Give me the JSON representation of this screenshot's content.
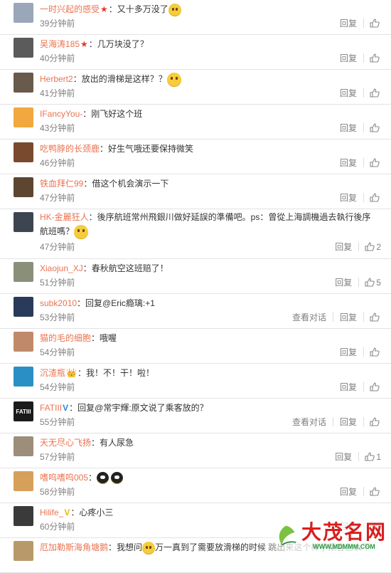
{
  "actions": {
    "reply": "回复",
    "view_thread": "查看对话"
  },
  "comments": [
    {
      "user": "一时兴起的感受",
      "badge": "★",
      "badge_type": "star",
      "text": "：又十多万没了",
      "emoji": "cat",
      "time": "39分钟前",
      "likes": "",
      "thread": false,
      "avatar": "#9aa7b8"
    },
    {
      "user": "吴海涛185",
      "badge": "★",
      "badge_type": "star",
      "text": "：几万块没了？",
      "emoji": "",
      "time": "40分钟前",
      "likes": "",
      "thread": false,
      "avatar": "#5b5b5b"
    },
    {
      "user": "Herbert2",
      "badge": "",
      "badge_type": "",
      "text": "：放出的滑梯是这样？？",
      "emoji": "smile",
      "time": "41分钟前",
      "likes": "",
      "thread": false,
      "avatar": "#6a5a4c"
    },
    {
      "user": "IFancyYou-",
      "badge": "",
      "badge_type": "",
      "text": "：刚飞好这个班",
      "emoji": "",
      "time": "43分钟前",
      "likes": "",
      "thread": false,
      "avatar": "#f1a83e"
    },
    {
      "user": "吃鸭脖的长颈鹿",
      "badge": "",
      "badge_type": "",
      "text": "：好生气哦还要保持微笑",
      "emoji": "",
      "time": "46分钟前",
      "likes": "",
      "thread": false,
      "avatar": "#7a4a2f"
    },
    {
      "user": "铁血拜仁99",
      "badge": "",
      "badge_type": "",
      "text": "：借这个机会演示一下",
      "emoji": "",
      "time": "47分钟前",
      "likes": "",
      "thread": false,
      "avatar": "#5c4630"
    },
    {
      "user": "HK-金麗狂人",
      "badge": "",
      "badge_type": "",
      "text": "：後序航班常州飛銀川做好延誤的準備吧。ps：曾從上海調機過去執行後序航班嗎？",
      "emoji": "smile",
      "time": "47分钟前",
      "likes": "2",
      "thread": false,
      "avatar": "#3d4550"
    },
    {
      "user": "Xiaojun_XJ",
      "badge": "",
      "badge_type": "",
      "text": "：春秋航空这班赔了！",
      "emoji": "",
      "time": "51分钟前",
      "likes": "5",
      "thread": false,
      "avatar": "#8a8f7a"
    },
    {
      "user": "subk2010",
      "badge": "",
      "badge_type": "",
      "text": "：回复@Eric瘾璃:+1",
      "emoji": "",
      "time": "53分钟前",
      "likes": "",
      "thread": true,
      "avatar": "#2a3a5a"
    },
    {
      "user": "猫的毛的细胞",
      "badge": "",
      "badge_type": "",
      "text": "：哦喔",
      "emoji": "",
      "time": "54分钟前",
      "likes": "",
      "thread": false,
      "avatar": "#c08a6a"
    },
    {
      "user": "沉渣瓶",
      "badge": "👑",
      "badge_type": "crown",
      "text": "：我！不！干！啦！",
      "emoji": "",
      "time": "54分钟前",
      "likes": "",
      "thread": false,
      "avatar": "#2a8fc4"
    },
    {
      "user": "FATIII",
      "badge": "V",
      "badge_type": "v",
      "text": "：回复@常宇輝:原文说了乘客放的？",
      "emoji": "",
      "time": "55分钟前",
      "likes": "",
      "thread": true,
      "avatar": "#1b1b1b",
      "avatar_text": "FATIII"
    },
    {
      "user": "天无尽心飞扬",
      "badge": "",
      "badge_type": "",
      "text": "：有人尿急",
      "emoji": "",
      "time": "57分钟前",
      "likes": "1",
      "thread": false,
      "avatar": "#9c8e7a"
    },
    {
      "user": "嗜呜嗜呜005",
      "badge": "",
      "badge_type": "",
      "text": "：",
      "emoji": "eyes",
      "time": "58分钟前",
      "likes": "",
      "thread": false,
      "avatar": "#d7a05a"
    },
    {
      "user": "Hilife_",
      "badge": "V",
      "badge_type": "vy",
      "text": "：心疼小三",
      "emoji": "",
      "time": "60分钟前",
      "likes": "",
      "thread": false,
      "avatar": "#3a3a3a"
    },
    {
      "user": "厄加勒斯海角塘鹅",
      "badge": "",
      "badge_type": "",
      "text": "：我想问",
      "emoji": "cat",
      "text2": "万一真到了需要放滑梯的时候 跳出来这个样子乘客怎么下",
      "time": "",
      "likes": "",
      "thread": false,
      "avatar": "#b89a6a"
    }
  ],
  "watermark": {
    "cn": "大茂名网",
    "url": "WWW.MDMMM.COM"
  }
}
